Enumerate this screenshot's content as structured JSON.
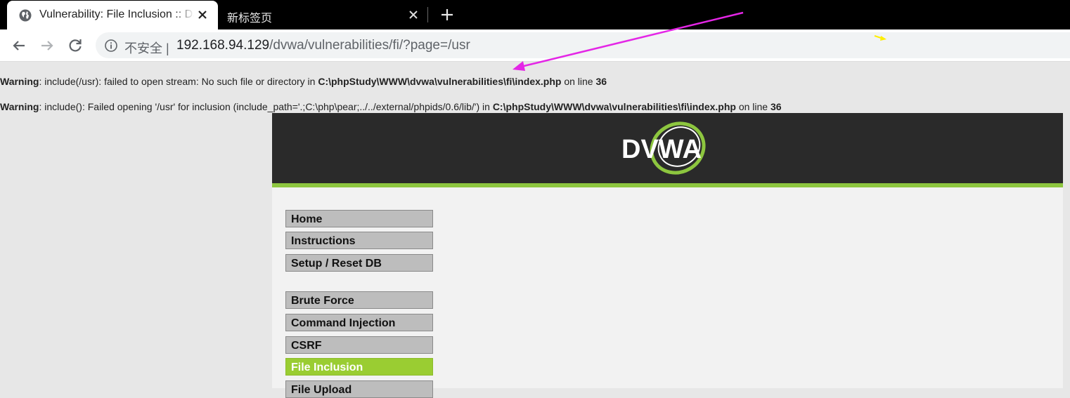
{
  "browser": {
    "tabs": [
      {
        "title": "Vulnerability: File Inclusion :: Damn Vulnerable Web Application (DVWA)",
        "active": true,
        "icon": "globe-icon"
      },
      {
        "title": "新标签页",
        "active": false
      }
    ],
    "address_bar": {
      "security_label": "不安全",
      "url_host": "192.168.94.129",
      "url_path": "/dvwa/vulnerabilities/fi/?page=/usr"
    }
  },
  "warnings": [
    {
      "label": "Warning",
      "message": ": include(/usr): failed to open stream: No such file or directory in ",
      "file": "C:\\phpStudy\\WWW\\dvwa\\vulnerabilities\\fi\\index.php",
      "on_line": " on line ",
      "line": "36"
    },
    {
      "label": "Warning",
      "message": ": include(): Failed opening '/usr' for inclusion (include_path='.;C:\\php\\pear;../../external/phpids/0.6/lib/') in ",
      "file": "C:\\phpStudy\\WWW\\dvwa\\vulnerabilities\\fi\\index.php",
      "on_line": " on line ",
      "line": "36"
    }
  ],
  "dvwa": {
    "logo_text": "DVWA",
    "menu": [
      {
        "label": "Home"
      },
      {
        "label": "Instructions"
      },
      {
        "label": "Setup / Reset DB"
      },
      {
        "label": "Brute Force"
      },
      {
        "label": "Command Injection"
      },
      {
        "label": "CSRF"
      },
      {
        "label": "File Inclusion",
        "selected": true
      },
      {
        "label": "File Upload"
      }
    ]
  },
  "colors": {
    "accent_green": "#8dc63f",
    "selected_menu": "#9acd32",
    "annotation_arrow": "#e426e6",
    "annotation_mark": "#ffee00"
  }
}
